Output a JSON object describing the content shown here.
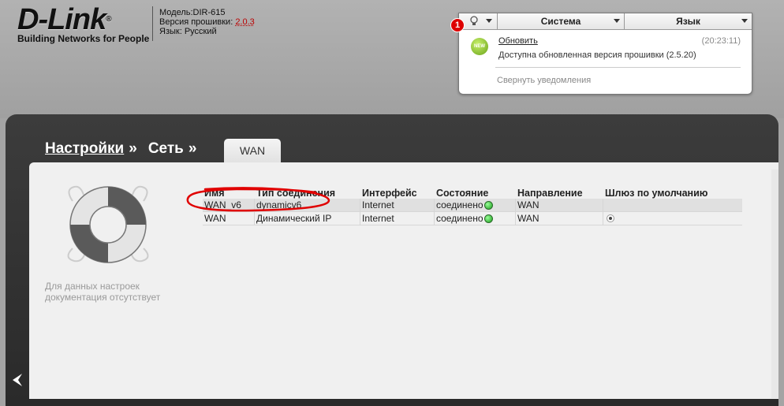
{
  "brand": {
    "logo_text": "D-Link",
    "logo_reg": "®",
    "tagline": "Building Networks for People"
  },
  "device": {
    "model_label": "Модель:",
    "model": "DIR-615",
    "firmware_label": "Версия прошивки:",
    "firmware": "2.0.3",
    "language_label": "Язык:",
    "language": "Русский"
  },
  "notifications": {
    "badge_count": "1",
    "system_tab": "Система",
    "language_tab": "Язык",
    "new_icon_text": "NEW",
    "item_title": "Обновить",
    "item_time": "(20:23:11)",
    "item_text": "Доступна обновленная версия прошивки (2.5.20)",
    "collapse": "Свернуть уведомления"
  },
  "breadcrumb": {
    "settings": "Настройки",
    "network": "Сеть",
    "sep": "»",
    "current_tab": "WAN"
  },
  "sidebar": {
    "no_doc": "Для данных настроек документация отсутствует"
  },
  "table": {
    "headers": [
      "Имя",
      "Тип соединения",
      "Интерфейс",
      "Состояние",
      "Направление",
      "Шлюз по умолчанию"
    ],
    "rows": [
      {
        "name": "WAN_v6",
        "type": "dynamicv6",
        "iface": "Internet",
        "state": "соединено",
        "direction": "WAN",
        "default_gw": false
      },
      {
        "name": "WAN",
        "type": "Динамический IP",
        "iface": "Internet",
        "state": "соединено",
        "direction": "WAN",
        "default_gw": true
      }
    ]
  },
  "colors": {
    "status_ok": "#1a9a1a",
    "annotation": "#e00000",
    "firmware_link": "#b00000"
  }
}
